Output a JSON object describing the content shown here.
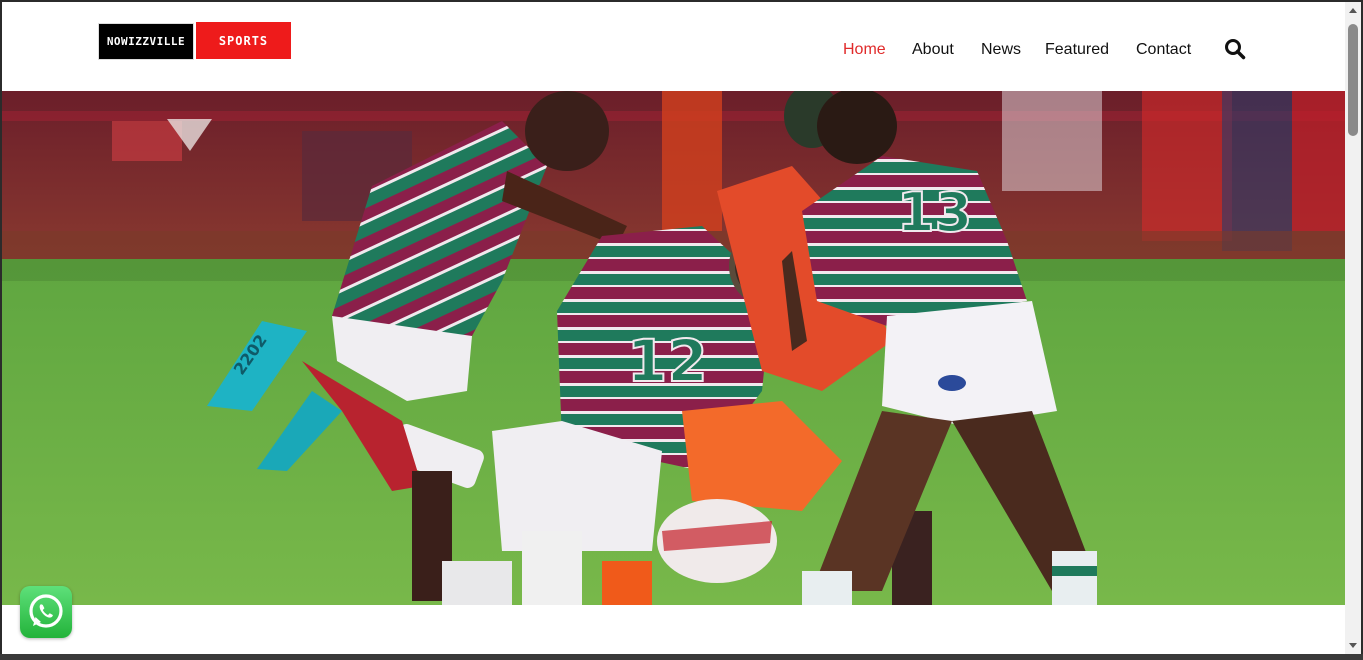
{
  "brand": {
    "logo_left": "NOWIZZVILLE",
    "logo_right": "SPORTS"
  },
  "nav": {
    "items": [
      {
        "label": "Home",
        "active": true
      },
      {
        "label": "About",
        "active": false
      },
      {
        "label": "News",
        "active": false
      },
      {
        "label": "Featured",
        "active": false
      },
      {
        "label": "Contact",
        "active": false
      }
    ],
    "search_icon": "search-icon"
  },
  "hero": {
    "jersey_numbers": [
      "12",
      "13"
    ],
    "boot_text": "2202"
  },
  "floating": {
    "whatsapp_icon": "whatsapp-icon"
  },
  "colors": {
    "accent": "#e02b2b",
    "logo_red": "#ee1b1b",
    "jersey_maroon": "#8b1f4a",
    "jersey_green": "#1f7a5c"
  }
}
